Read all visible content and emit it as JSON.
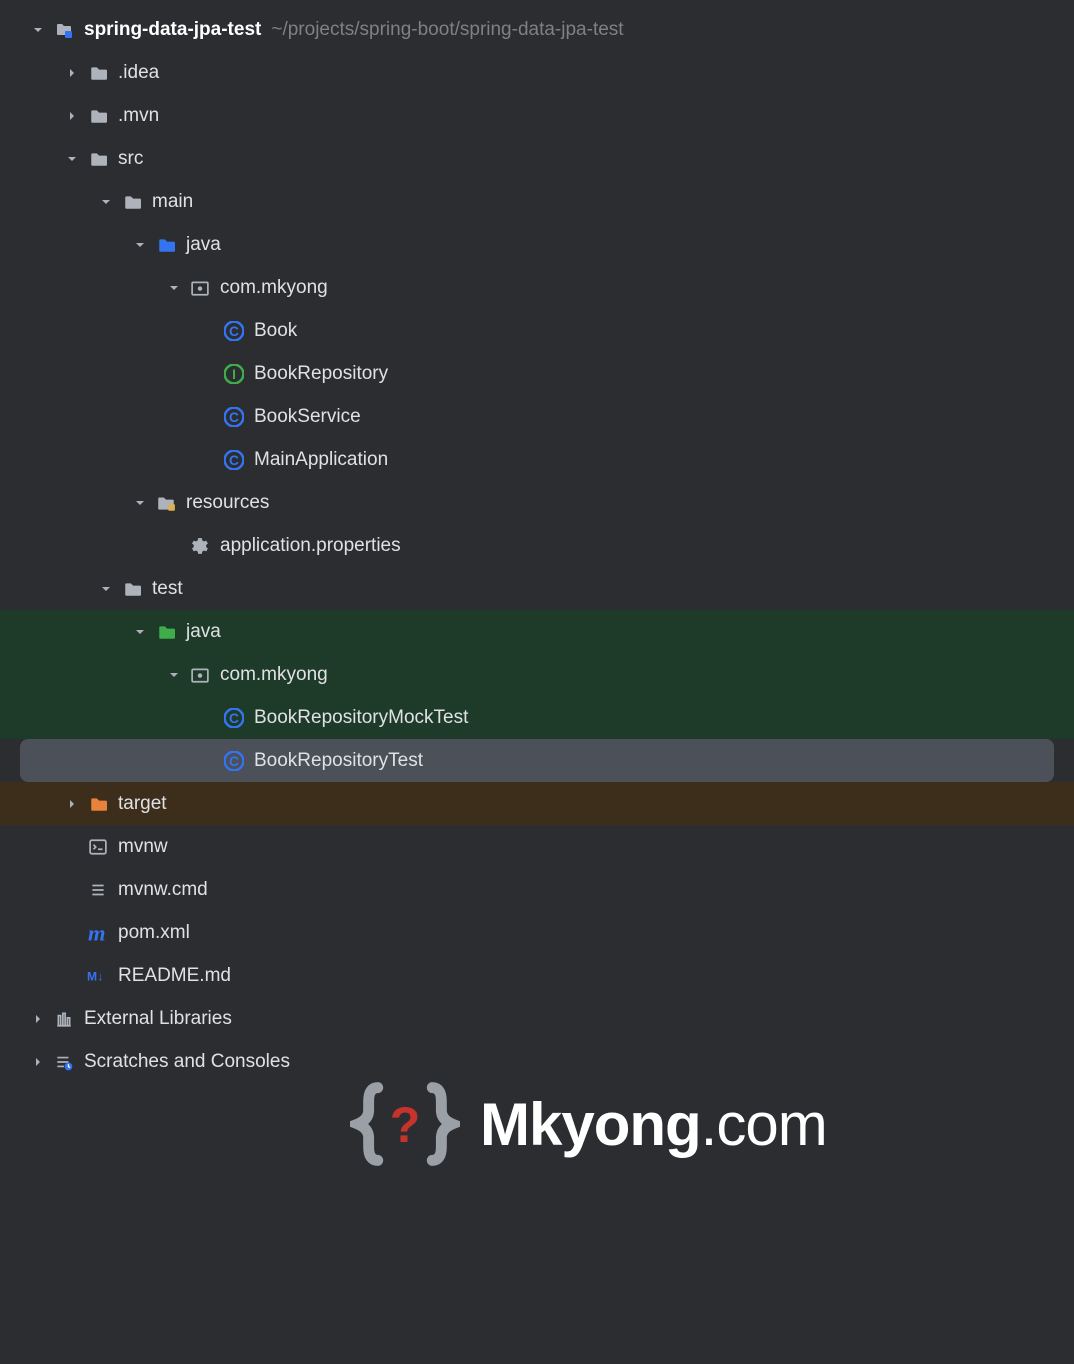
{
  "root": {
    "name": "spring-data-jpa-test",
    "path": "~/projects/spring-boot/spring-data-jpa-test"
  },
  "nodes": {
    "idea": ".idea",
    "mvn": ".mvn",
    "src": "src",
    "main": "main",
    "main_java": "java",
    "main_pkg": "com.mkyong",
    "book": "Book",
    "book_repo": "BookRepository",
    "book_service": "BookService",
    "main_app": "MainApplication",
    "resources": "resources",
    "app_props": "application.properties",
    "test": "test",
    "test_java": "java",
    "test_pkg": "com.mkyong",
    "mock_test": "BookRepositoryMockTest",
    "repo_test": "BookRepositoryTest",
    "target": "target",
    "mvnw": "mvnw",
    "mvnw_cmd": "mvnw.cmd",
    "pom": "pom.xml",
    "readme": "README.md",
    "ext_libs": "External Libraries",
    "scratches": "Scratches and Consoles"
  },
  "watermark": {
    "brand1": "Mkyong",
    "brand2": ".com"
  }
}
